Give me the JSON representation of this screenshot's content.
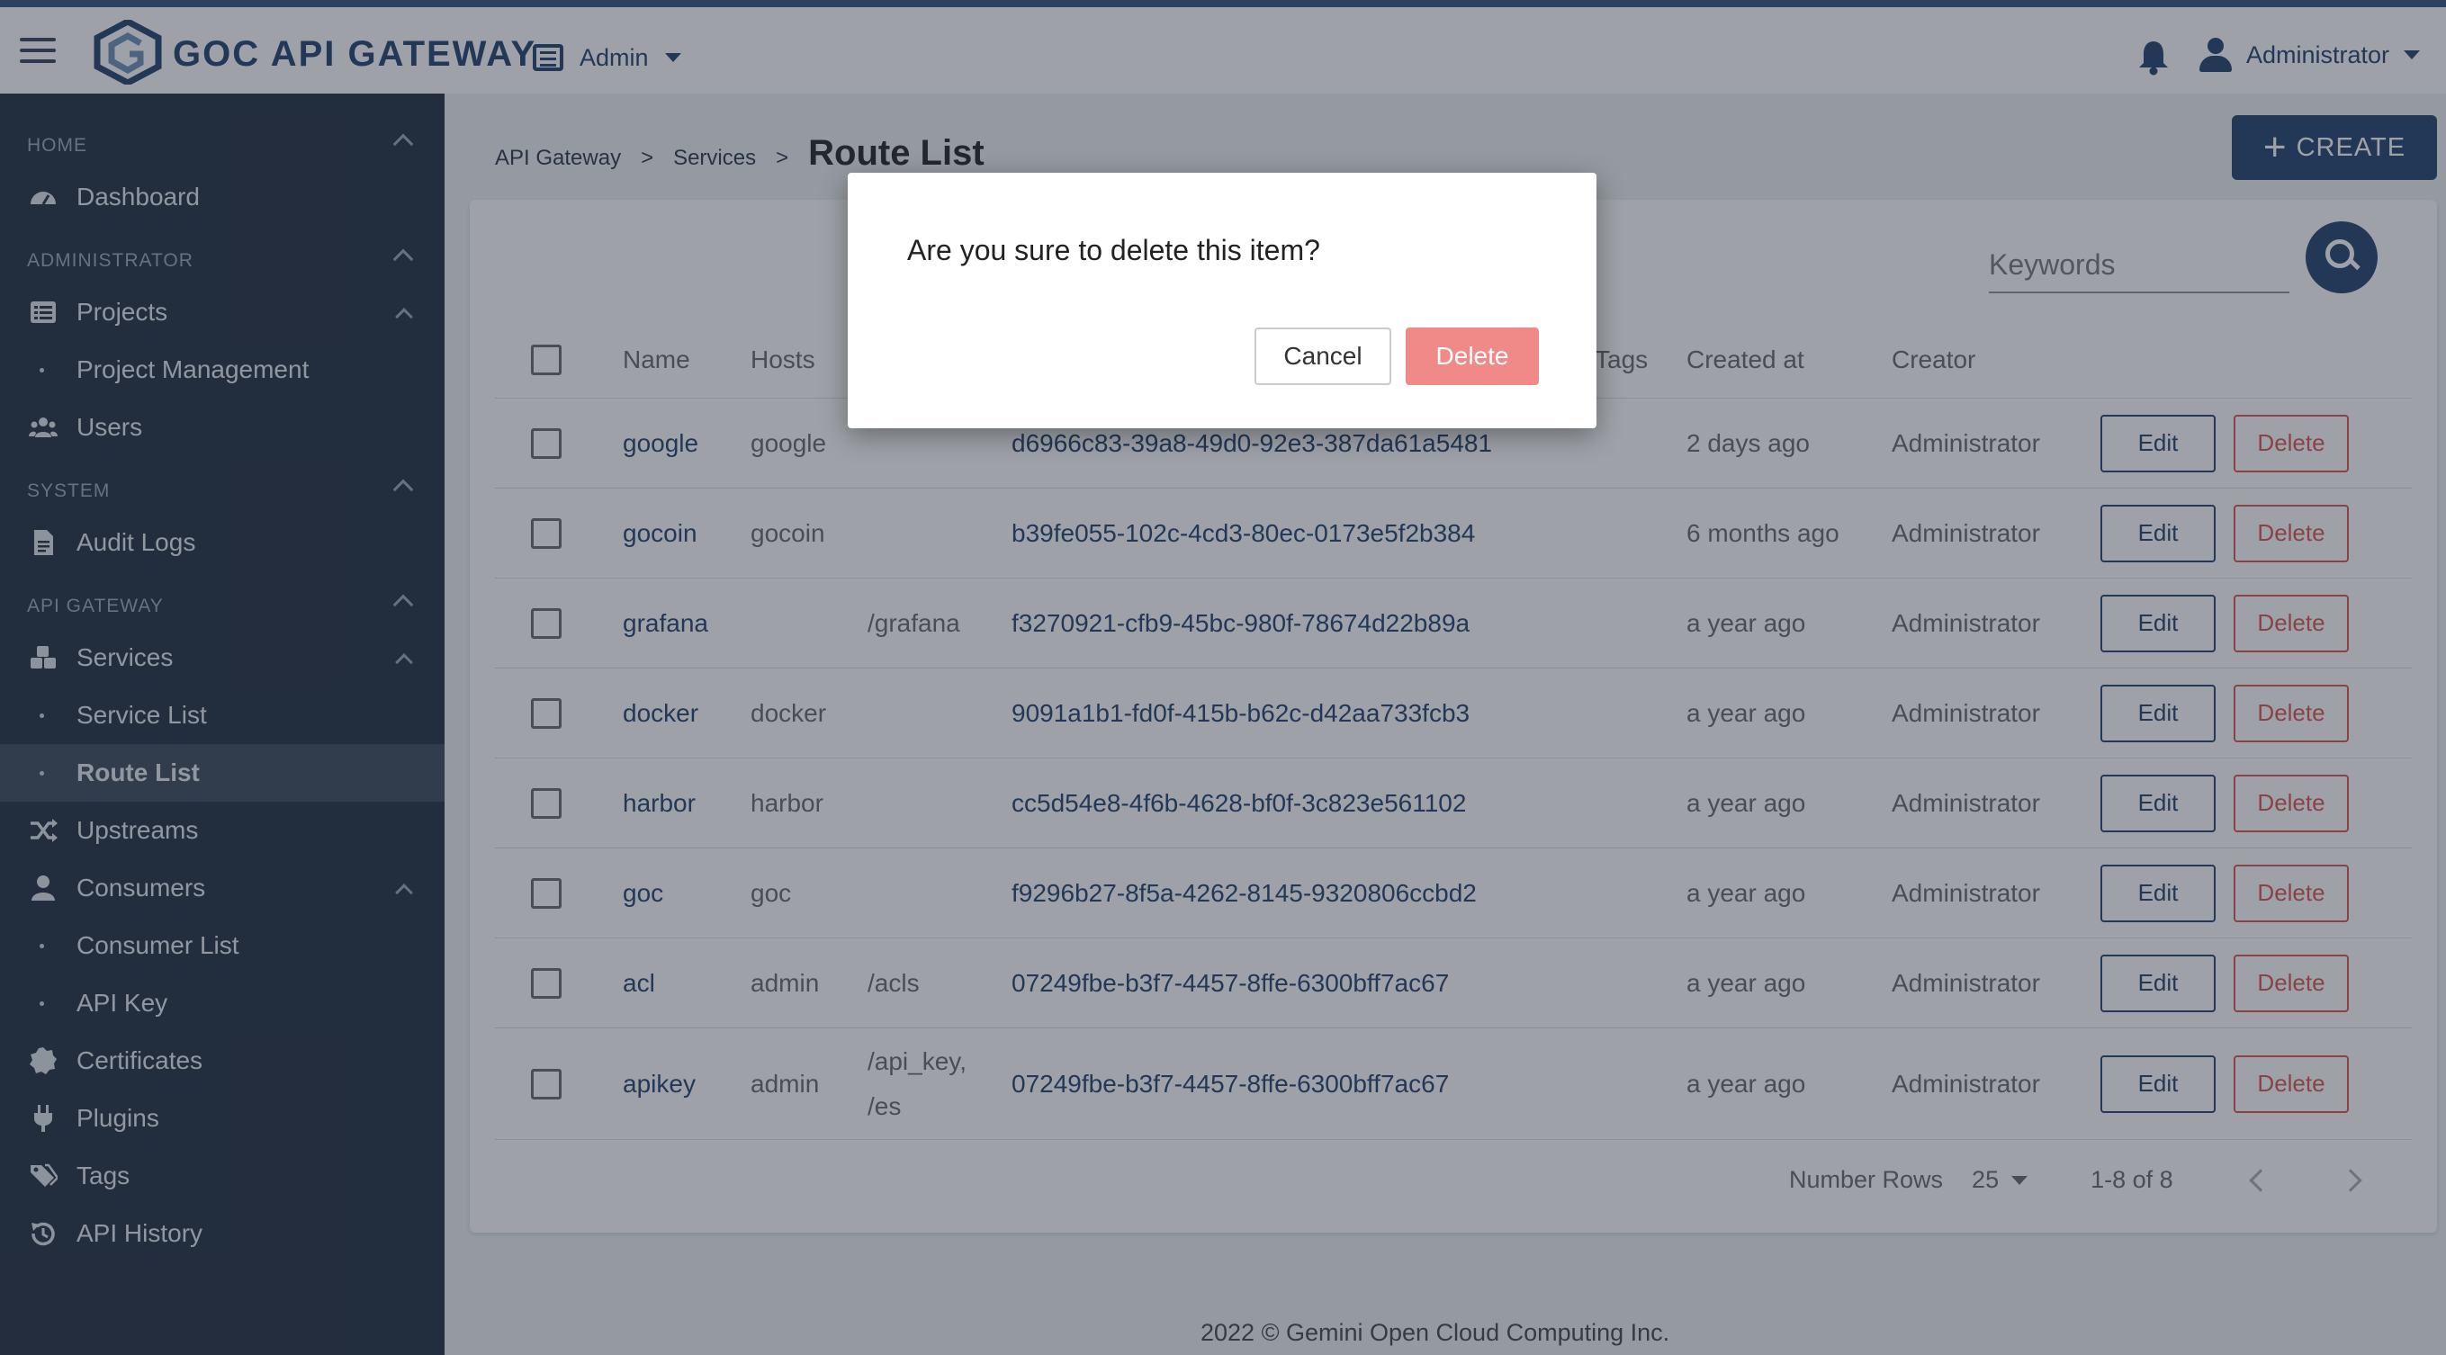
{
  "app": {
    "brand": "GOC API GATEWAY",
    "admin_label": "Admin",
    "user_name": "Administrator"
  },
  "sidebar": {
    "sections": {
      "home": "HOME",
      "administrator": "ADMINISTRATOR",
      "system": "SYSTEM",
      "api_gateway": "API GATEWAY"
    },
    "items": {
      "dashboard": "Dashboard",
      "projects": "Projects",
      "project_management": "Project Management",
      "users": "Users",
      "audit_logs": "Audit Logs",
      "services": "Services",
      "service_list": "Service List",
      "route_list": "Route List",
      "upstreams": "Upstreams",
      "consumers": "Consumers",
      "consumer_list": "Consumer List",
      "api_key": "API Key",
      "certificates": "Certificates",
      "plugins": "Plugins",
      "tags": "Tags",
      "api_history": "API History"
    }
  },
  "breadcrumb": {
    "level1": "API Gateway",
    "sep": ">",
    "level2": "Services",
    "current": "Route List"
  },
  "toolbar": {
    "create_label": "CREATE",
    "search_placeholder": "Keywords"
  },
  "table": {
    "columns": {
      "name": "Name",
      "hosts": "Hosts",
      "tags": "Tags",
      "created": "Created at",
      "creator": "Creator"
    },
    "edit_label": "Edit",
    "delete_label": "Delete",
    "rows": [
      {
        "name": "google",
        "hosts": "google",
        "paths": "",
        "id": "d6966c83-39a8-49d0-92e3-387da61a5481",
        "created": "2 days ago",
        "creator": "Administrator"
      },
      {
        "name": "gocoin",
        "hosts": "gocoin",
        "paths": "",
        "id": "b39fe055-102c-4cd3-80ec-0173e5f2b384",
        "created": "6 months ago",
        "creator": "Administrator"
      },
      {
        "name": "grafana",
        "hosts": "",
        "paths": "/grafana",
        "id": "f3270921-cfb9-45bc-980f-78674d22b89a",
        "created": "a year ago",
        "creator": "Administrator"
      },
      {
        "name": "docker",
        "hosts": "docker",
        "paths": "",
        "id": "9091a1b1-fd0f-415b-b62c-d42aa733fcb3",
        "created": "a year ago",
        "creator": "Administrator"
      },
      {
        "name": "harbor",
        "hosts": "harbor",
        "paths": "",
        "id": "cc5d54e8-4f6b-4628-bf0f-3c823e561102",
        "created": "a year ago",
        "creator": "Administrator"
      },
      {
        "name": "goc",
        "hosts": "goc",
        "paths": "",
        "id": "f9296b27-8f5a-4262-8145-9320806ccbd2",
        "created": "a year ago",
        "creator": "Administrator"
      },
      {
        "name": "acl",
        "hosts": "admin",
        "paths": "/acls",
        "id": "07249fbe-b3f7-4457-8ffe-6300bff7ac67",
        "created": "a year ago",
        "creator": "Administrator"
      },
      {
        "name": "apikey",
        "hosts": "admin",
        "paths": "/api_key,\n/es",
        "id": "07249fbe-b3f7-4457-8ffe-6300bff7ac67",
        "created": "a year ago",
        "creator": "Administrator"
      }
    ]
  },
  "pagination": {
    "rows_label": "Number Rows",
    "rows_value": "25",
    "range": "1-8 of 8"
  },
  "footer": {
    "text": "2022 © Gemini Open Cloud Computing Inc."
  },
  "dialog": {
    "message": "Are you sure to delete this item?",
    "cancel_label": "Cancel",
    "confirm_label": "Delete"
  },
  "colors": {
    "brand": "#1f3d6b",
    "sidebar": "#1e2a3e",
    "danger": "#d9534f",
    "danger_soft": "#f08a88"
  }
}
